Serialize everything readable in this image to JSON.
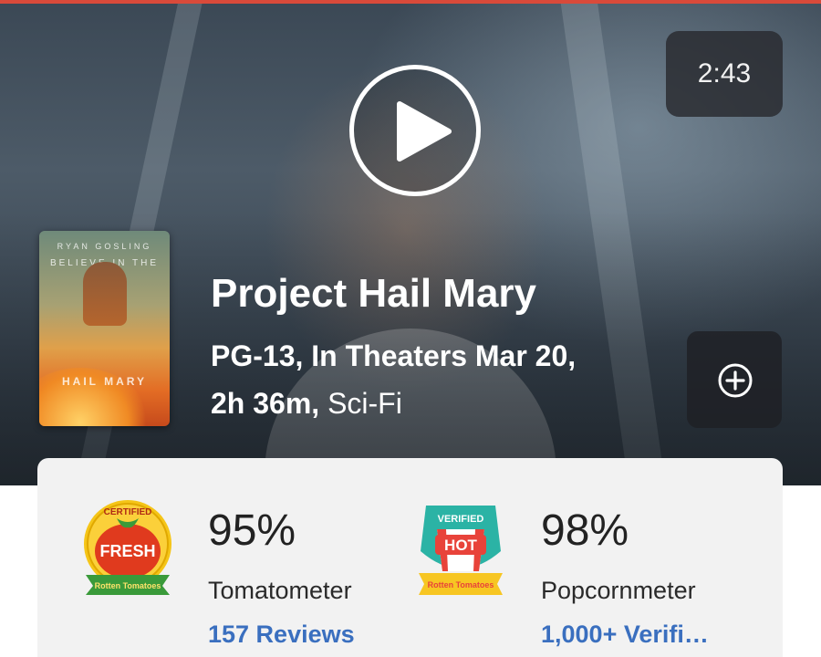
{
  "hero": {
    "duration": "2:43"
  },
  "movie": {
    "title": "Project Hail Mary",
    "rating_release": "PG-13, In Theaters Mar 20,",
    "runtime": "2h 36m,",
    "genre": "Sci-Fi"
  },
  "poster": {
    "top_text": "RYAN GOSLING",
    "tagline": "BELIEVE IN THE",
    "title_text": "HAIL MARY"
  },
  "scores": {
    "tomatometer": {
      "percent": "95%",
      "label": "Tomatometer",
      "reviews": "157 Reviews",
      "badge_top": "CERTIFIED",
      "badge_main": "FRESH",
      "badge_brand": "Rotten Tomatoes"
    },
    "popcornmeter": {
      "percent": "98%",
      "label": "Popcornmeter",
      "reviews": "1,000+ Verifi…",
      "badge_top": "VERIFIED",
      "badge_main": "HOT",
      "badge_brand": "Rotten Tomatoes"
    }
  },
  "colors": {
    "accent": "#d94a3a",
    "link": "#3a6fbf",
    "card_bg": "#f2f2f2"
  },
  "icons": {
    "play": "play-icon",
    "add": "plus-circle-icon"
  }
}
